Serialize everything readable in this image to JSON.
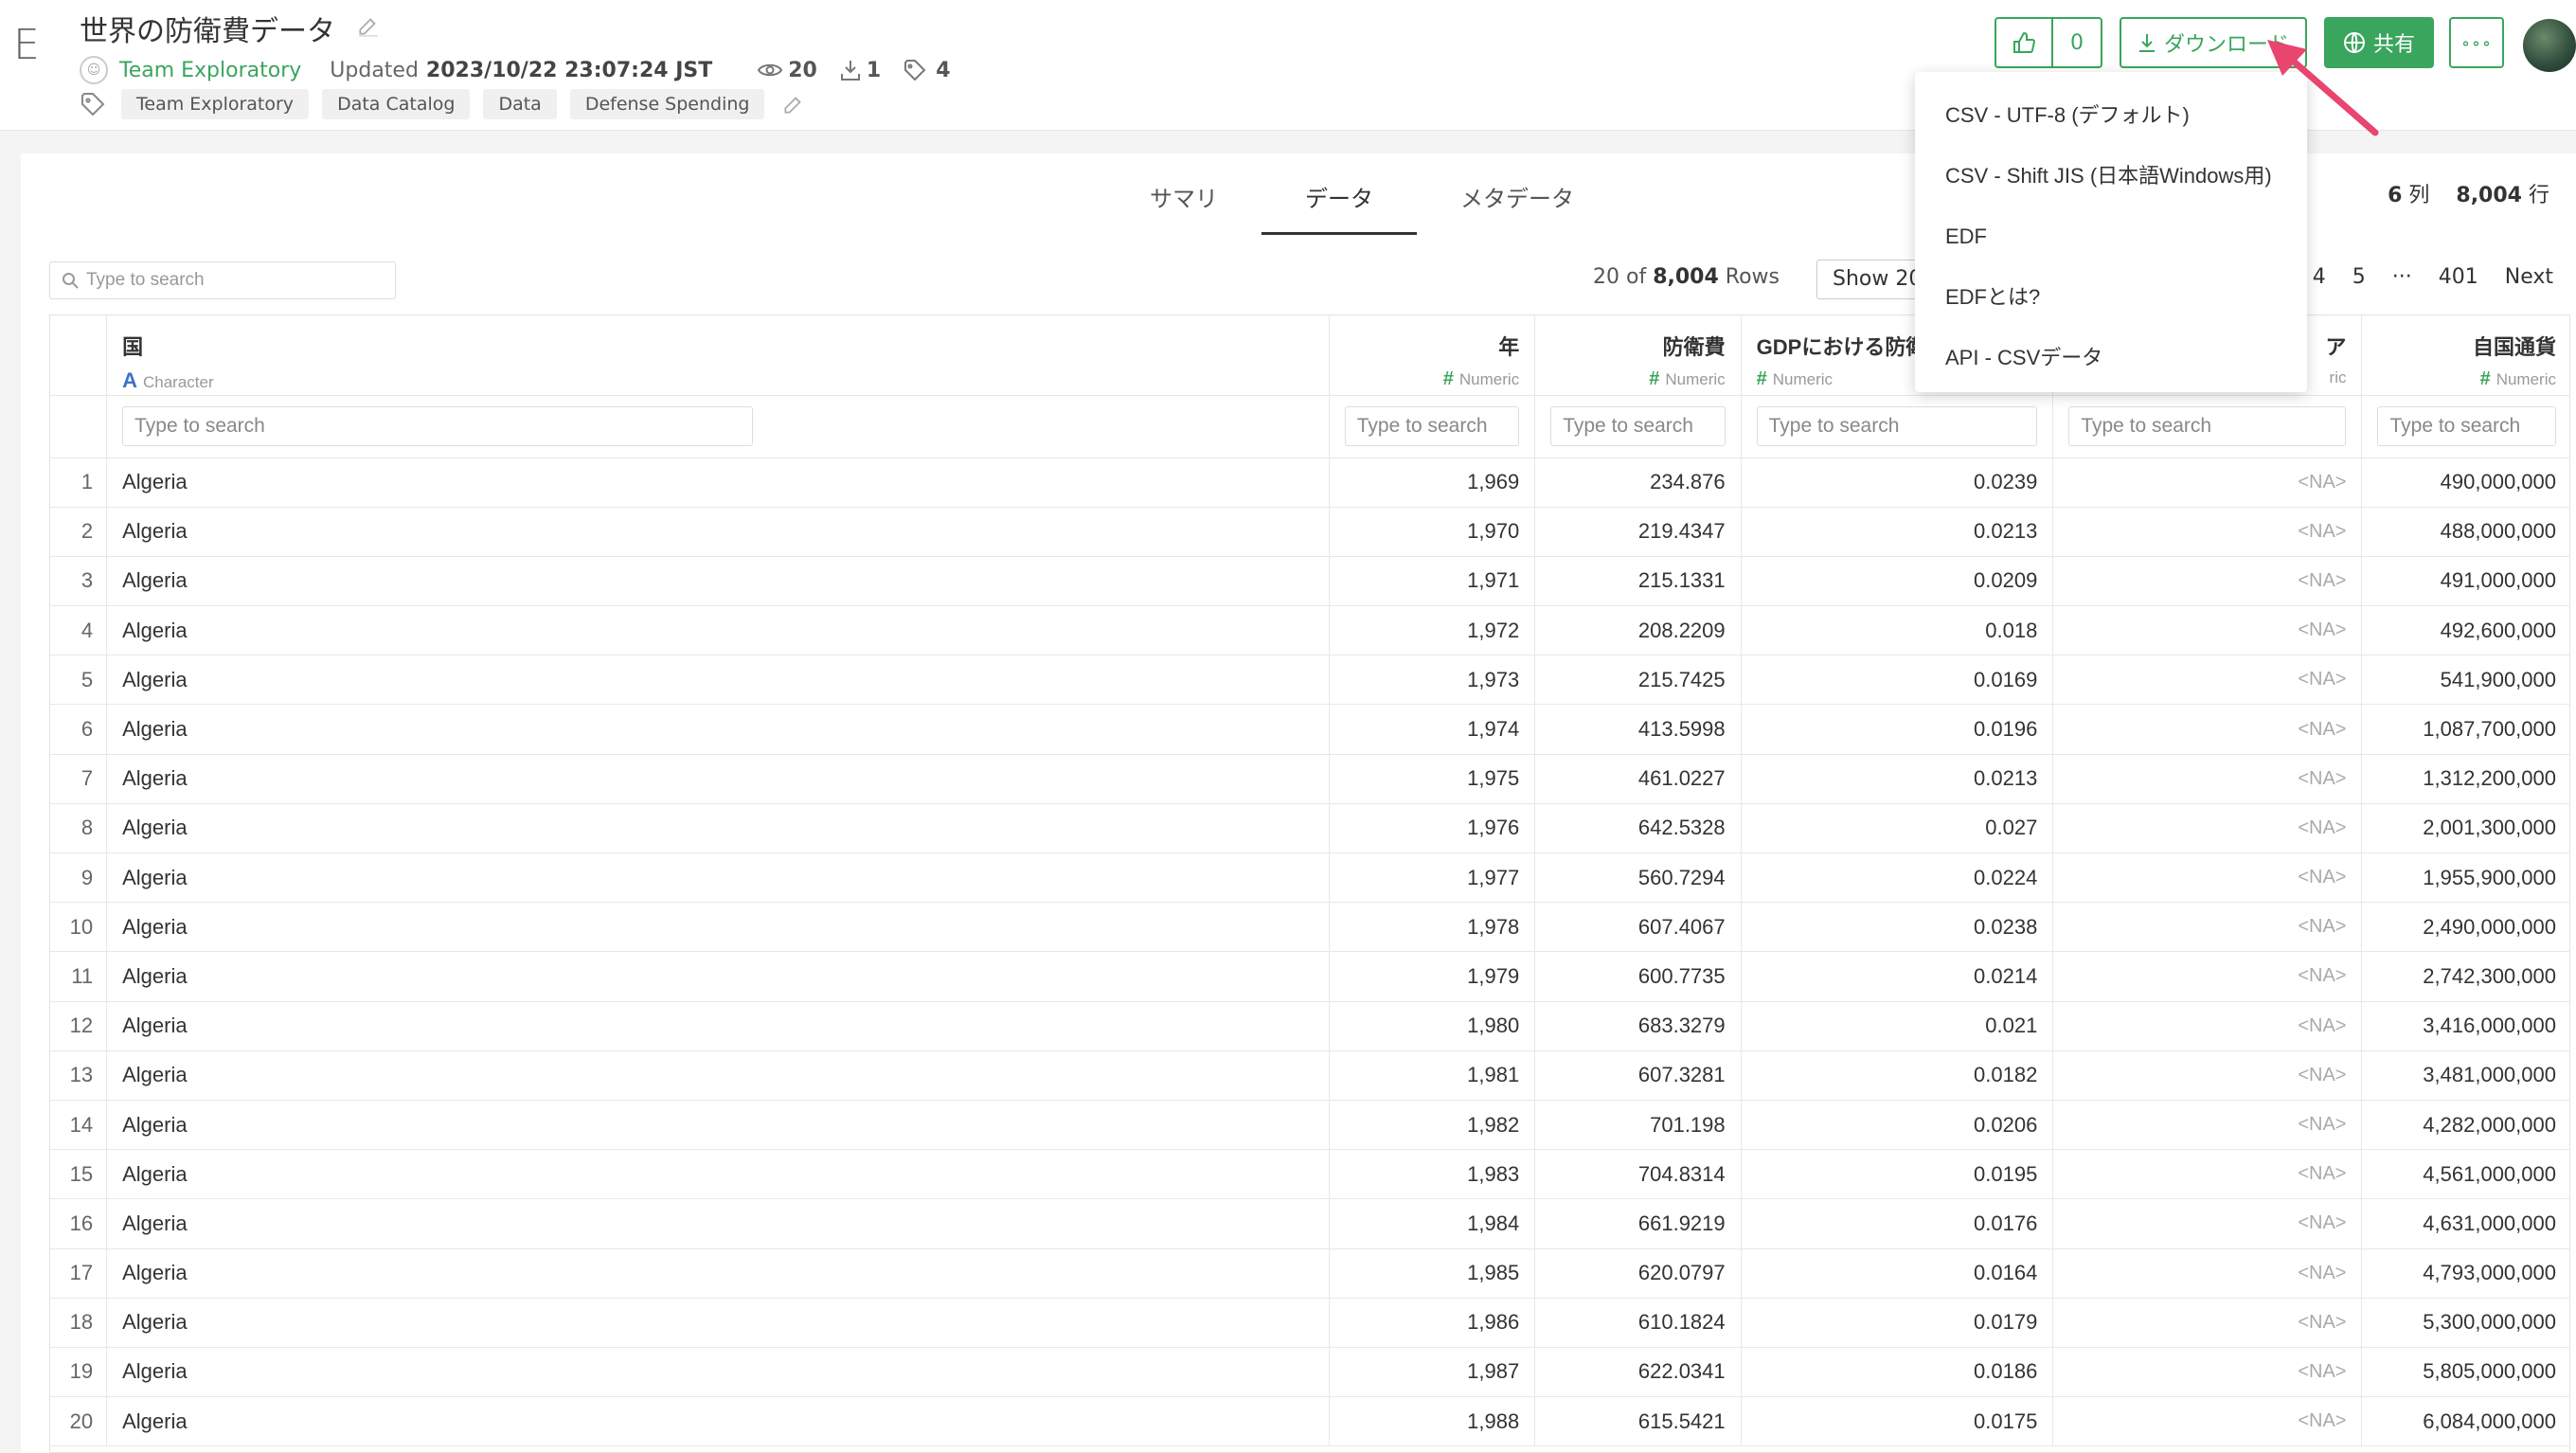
{
  "app": {
    "logo": "E"
  },
  "header": {
    "title": "世界の防衛費データ",
    "team": "Team Exploratory",
    "updated_label": "Updated",
    "updated_value": "2023/10/22 23:07:24 JST",
    "views": "20",
    "downloads": "1",
    "tag_count": "4",
    "tags": [
      "Team Exploratory",
      "Data Catalog",
      "Data",
      "Defense Spending"
    ],
    "like_count": "0",
    "download_label": "ダウンロード",
    "share_label": "共有",
    "more_label": "∘∘∘"
  },
  "dropdown": {
    "items": [
      "CSV - UTF-8 (デフォルト)",
      "CSV - Shift JIS (日本語Windows用)",
      "EDF",
      "EDFとは?",
      "API - CSVデータ"
    ]
  },
  "tabs": [
    "サマリ",
    "データ",
    "メタデータ"
  ],
  "active_tab": "データ",
  "dims": {
    "cols": "6",
    "cols_unit": "列",
    "rows": "8,004",
    "rows_unit": "行"
  },
  "search": {
    "placeholder": "Type to search"
  },
  "rows_info": {
    "prefix": "20 of",
    "total": "8,004",
    "suffix": "Rows"
  },
  "show_select": "Show 20",
  "pager": [
    "4",
    "5",
    "···",
    "401",
    "Next"
  ],
  "columns": [
    {
      "name": "国",
      "type": "Character",
      "icon": "A"
    },
    {
      "name": "年",
      "type": "Numeric",
      "icon": "#"
    },
    {
      "name": "防衛費",
      "type": "Numeric",
      "icon": "#"
    },
    {
      "name": "GDPにおける防衛費",
      "type": "Numeric",
      "icon": "#"
    },
    {
      "name": "ア",
      "type": "ric",
      "icon": ""
    },
    {
      "name": "自国通貨",
      "type": "Numeric",
      "icon": "#"
    }
  ],
  "filter_placeholder": "Type to search",
  "rows": [
    [
      "1",
      "Algeria",
      "1,969",
      "234.876",
      "0.0239",
      "<NA>",
      "490,000,000"
    ],
    [
      "2",
      "Algeria",
      "1,970",
      "219.4347",
      "0.0213",
      "<NA>",
      "488,000,000"
    ],
    [
      "3",
      "Algeria",
      "1,971",
      "215.1331",
      "0.0209",
      "<NA>",
      "491,000,000"
    ],
    [
      "4",
      "Algeria",
      "1,972",
      "208.2209",
      "0.018",
      "<NA>",
      "492,600,000"
    ],
    [
      "5",
      "Algeria",
      "1,973",
      "215.7425",
      "0.0169",
      "<NA>",
      "541,900,000"
    ],
    [
      "6",
      "Algeria",
      "1,974",
      "413.5998",
      "0.0196",
      "<NA>",
      "1,087,700,000"
    ],
    [
      "7",
      "Algeria",
      "1,975",
      "461.0227",
      "0.0213",
      "<NA>",
      "1,312,200,000"
    ],
    [
      "8",
      "Algeria",
      "1,976",
      "642.5328",
      "0.027",
      "<NA>",
      "2,001,300,000"
    ],
    [
      "9",
      "Algeria",
      "1,977",
      "560.7294",
      "0.0224",
      "<NA>",
      "1,955,900,000"
    ],
    [
      "10",
      "Algeria",
      "1,978",
      "607.4067",
      "0.0238",
      "<NA>",
      "2,490,000,000"
    ],
    [
      "11",
      "Algeria",
      "1,979",
      "600.7735",
      "0.0214",
      "<NA>",
      "2,742,300,000"
    ],
    [
      "12",
      "Algeria",
      "1,980",
      "683.3279",
      "0.021",
      "<NA>",
      "3,416,000,000"
    ],
    [
      "13",
      "Algeria",
      "1,981",
      "607.3281",
      "0.0182",
      "<NA>",
      "3,481,000,000"
    ],
    [
      "14",
      "Algeria",
      "1,982",
      "701.198",
      "0.0206",
      "<NA>",
      "4,282,000,000"
    ],
    [
      "15",
      "Algeria",
      "1,983",
      "704.8314",
      "0.0195",
      "<NA>",
      "4,561,000,000"
    ],
    [
      "16",
      "Algeria",
      "1,984",
      "661.9219",
      "0.0176",
      "<NA>",
      "4,631,000,000"
    ],
    [
      "17",
      "Algeria",
      "1,985",
      "620.0797",
      "0.0164",
      "<NA>",
      "4,793,000,000"
    ],
    [
      "18",
      "Algeria",
      "1,986",
      "610.1824",
      "0.0179",
      "<NA>",
      "5,300,000,000"
    ],
    [
      "19",
      "Algeria",
      "1,987",
      "622.0341",
      "0.0186",
      "<NA>",
      "5,805,000,000"
    ],
    [
      "20",
      "Algeria",
      "1,988",
      "615.5421",
      "0.0175",
      "<NA>",
      "6,084,000,000"
    ]
  ],
  "colors": {
    "accent": "#3aa55d",
    "char_icon": "#3b73c6",
    "arrow": "#e8456f"
  }
}
